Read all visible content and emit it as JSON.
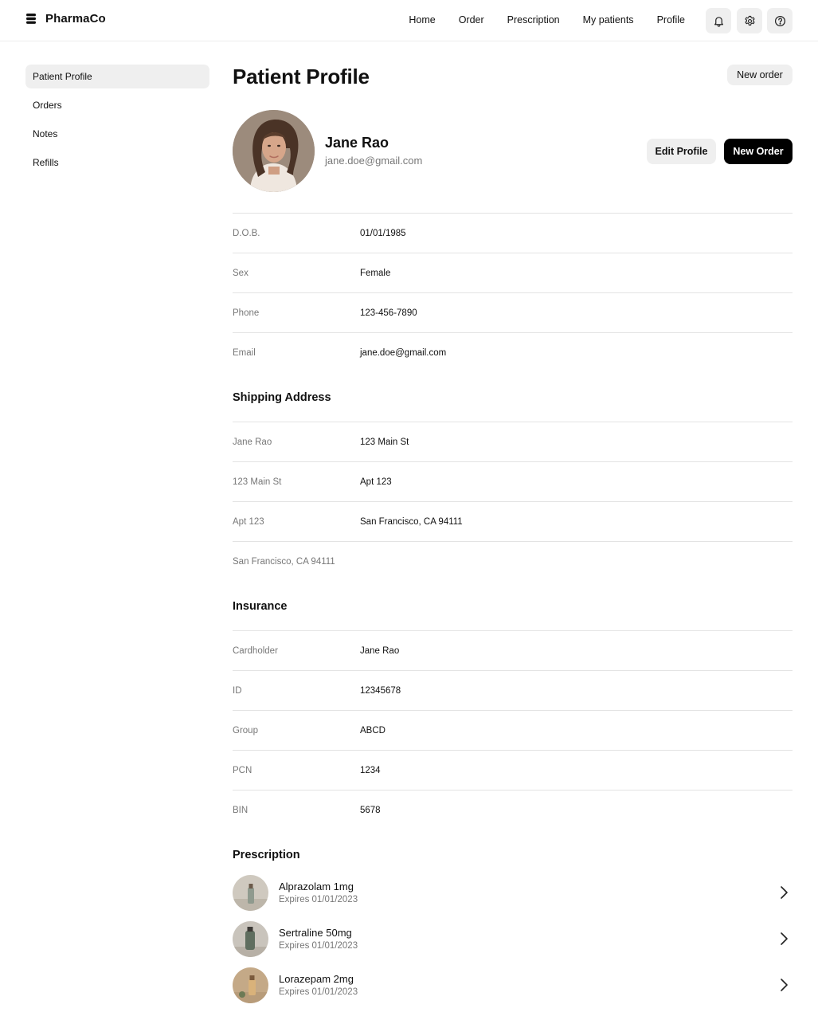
{
  "brand": {
    "name": "PharmaCo"
  },
  "nav": [
    "Home",
    "Order",
    "Prescription",
    "My patients",
    "Profile"
  ],
  "header_icons": [
    "bell-icon",
    "gear-icon",
    "help-icon"
  ],
  "sidebar": {
    "items": [
      "Patient Profile",
      "Orders",
      "Notes",
      "Refills"
    ],
    "active": "Patient Profile"
  },
  "page": {
    "title": "Patient Profile",
    "new_order_label": "New order"
  },
  "patient": {
    "name": "Jane Rao",
    "email": "jane.doe@gmail.com",
    "edit_label": "Edit Profile",
    "new_order_label": "New Order"
  },
  "details": [
    {
      "label": "D.O.B.",
      "value": "01/01/1985"
    },
    {
      "label": "Sex",
      "value": "Female"
    },
    {
      "label": "Phone",
      "value": "123-456-7890"
    },
    {
      "label": "Email",
      "value": "jane.doe@gmail.com"
    }
  ],
  "shipping": {
    "title": "Shipping Address",
    "rows": [
      {
        "label": "Jane Rao",
        "value": "123 Main St"
      },
      {
        "label": "123 Main St",
        "value": "Apt 123"
      },
      {
        "label": "Apt 123",
        "value": "San Francisco, CA 94111"
      },
      {
        "label": "San Francisco, CA 94111",
        "value": ""
      }
    ]
  },
  "insurance": {
    "title": "Insurance",
    "rows": [
      {
        "label": "Cardholder",
        "value": "Jane Rao"
      },
      {
        "label": "ID",
        "value": "12345678"
      },
      {
        "label": "Group",
        "value": "ABCD"
      },
      {
        "label": "PCN",
        "value": "1234"
      },
      {
        "label": "BIN",
        "value": "5678"
      }
    ]
  },
  "prescription": {
    "title": "Prescription",
    "items": [
      {
        "name": "Alprazolam 1mg",
        "expires": "Expires 01/01/2023"
      },
      {
        "name": "Sertraline 50mg",
        "expires": "Expires 01/01/2023"
      },
      {
        "name": "Lorazepam 2mg",
        "expires": "Expires 01/01/2023"
      }
    ]
  }
}
